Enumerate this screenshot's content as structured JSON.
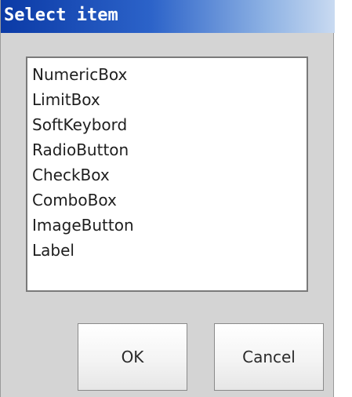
{
  "dialog": {
    "title": "Select item",
    "items": [
      "NumericBox",
      "LimitBox",
      "SoftKeybord",
      "RadioButton",
      "CheckBox",
      "ComboBox",
      "ImageButton",
      "Label"
    ],
    "ok_label": "OK",
    "cancel_label": "Cancel"
  },
  "colors": {
    "titlebar_start": "#0b3aa6",
    "titlebar_end": "#c9daf1",
    "dialog_bg": "#d4d4d4",
    "list_bg": "#ffffff"
  }
}
